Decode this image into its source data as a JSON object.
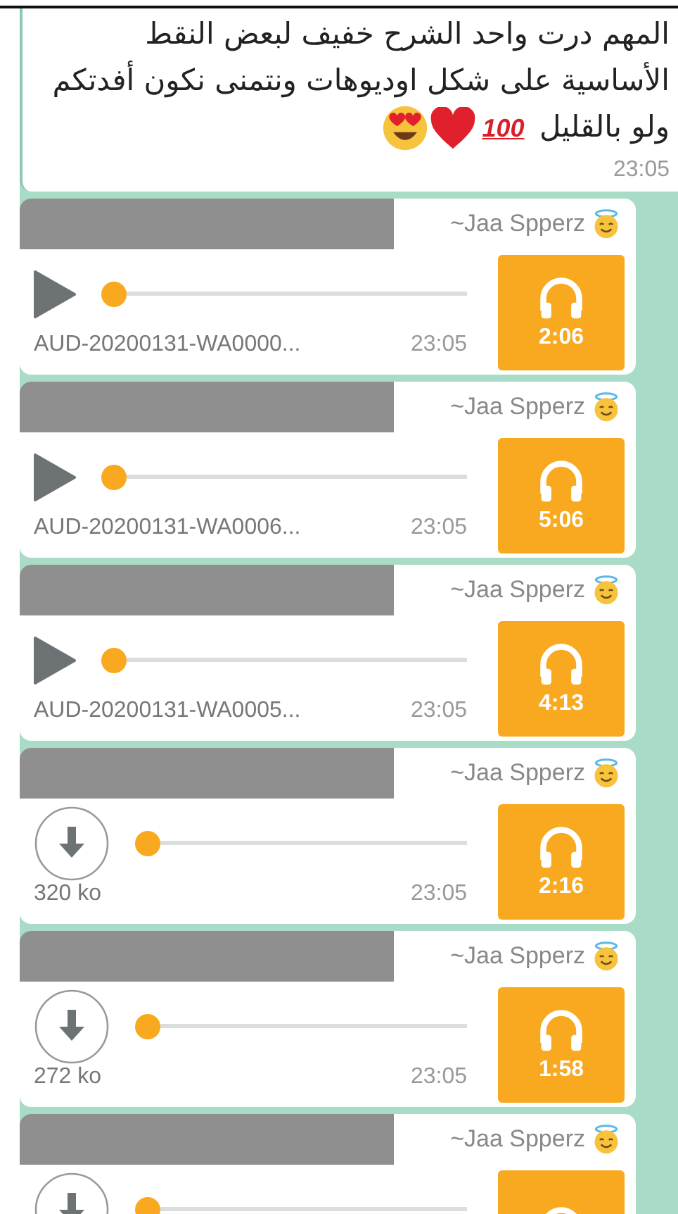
{
  "message": {
    "text": "المهم درت واحد الشرح خفيف لبعض النقط الأساسية على شكل اوديوهات ونتمنى نكون أفدتكم ولو بالقليل",
    "emojis": [
      {
        "kind": "hundred",
        "text": "100"
      },
      {
        "kind": "heart"
      },
      {
        "kind": "heart_eyes"
      }
    ],
    "time": "23:05"
  },
  "audio_messages": [
    {
      "sender": "~Jaa Spperz",
      "kind": "play",
      "file": "AUD-20200131-WA0000...",
      "time": "23:05",
      "duration": "2:06",
      "level": 0
    },
    {
      "sender": "~Jaa Spperz",
      "kind": "play",
      "file": "AUD-20200131-WA0006...",
      "time": "23:05",
      "duration": "5:06",
      "level": 0
    },
    {
      "sender": "~Jaa Spperz",
      "kind": "play",
      "file": "AUD-20200131-WA0005...",
      "time": "23:05",
      "duration": "4:13",
      "level": 0
    },
    {
      "sender": "~Jaa Spperz",
      "kind": "download",
      "file": "320 ko",
      "time": "23:05",
      "duration": "2:16",
      "level": 0
    },
    {
      "sender": "~Jaa Spperz",
      "kind": "download",
      "file": "272 ko",
      "time": "23:05",
      "duration": "1:58",
      "level": 0
    },
    {
      "sender": "~Jaa Spperz",
      "kind": "download",
      "level": 0
    }
  ]
}
